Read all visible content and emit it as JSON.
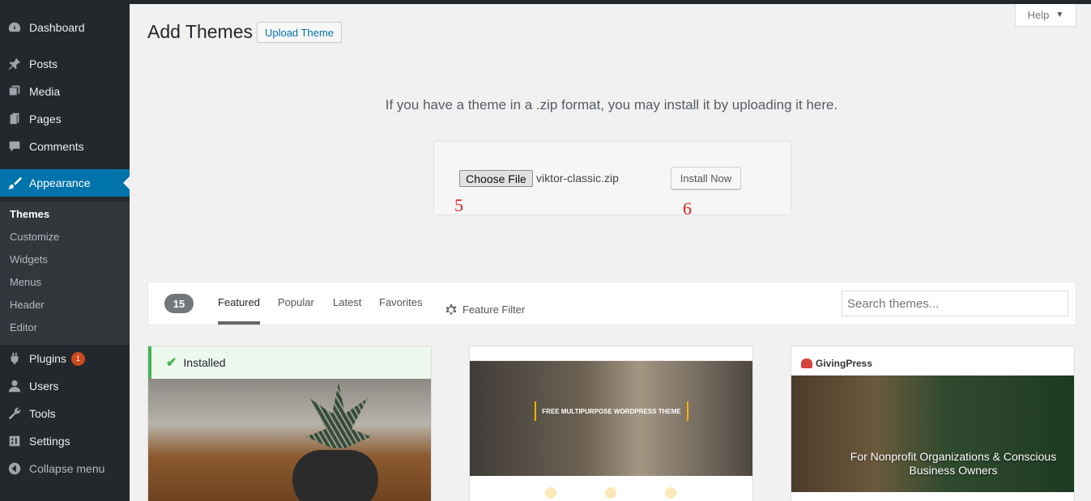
{
  "sidebar": {
    "items": [
      {
        "label": "Dashboard",
        "icon": "dashboard-icon"
      },
      {
        "label": "Posts",
        "icon": "pin-icon"
      },
      {
        "label": "Media",
        "icon": "media-icon"
      },
      {
        "label": "Pages",
        "icon": "pages-icon"
      },
      {
        "label": "Comments",
        "icon": "comment-icon"
      },
      {
        "label": "Appearance",
        "icon": "brush-icon"
      },
      {
        "label": "Plugins",
        "icon": "plug-icon",
        "badge": "1"
      },
      {
        "label": "Users",
        "icon": "user-icon"
      },
      {
        "label": "Tools",
        "icon": "wrench-icon"
      },
      {
        "label": "Settings",
        "icon": "settings-icon"
      },
      {
        "label": "Collapse menu",
        "icon": "collapse-icon"
      }
    ],
    "submenu": [
      "Themes",
      "Customize",
      "Widgets",
      "Menus",
      "Header",
      "Editor"
    ]
  },
  "header": {
    "title": "Add Themes",
    "upload_button": "Upload Theme",
    "help": "Help"
  },
  "upload": {
    "description": "If you have a theme in a .zip format, you may install it by uploading it here.",
    "choose_file": "Choose File",
    "file_name": "viktor-classic.zip",
    "install_button": "Install Now",
    "step_a": "5",
    "step_b": "6"
  },
  "filter": {
    "count": "15",
    "tabs": [
      "Featured",
      "Popular",
      "Latest",
      "Favorites"
    ],
    "feature_filter": "Feature Filter",
    "search_placeholder": "Search themes..."
  },
  "themes": {
    "installed_label": "Installed",
    "card2_banner": "FREE MULTIPURPOSE WORDPRESS THEME",
    "card3_brand": "GivingPress",
    "card3_headline": "For Nonprofit Organizations & Conscious Business Owners"
  },
  "colors": {
    "sidebar": "#23282d",
    "accent": "#0073aa",
    "installed": "#46b450",
    "badge": "#ca4a1f",
    "step_marker": "#e02020"
  }
}
